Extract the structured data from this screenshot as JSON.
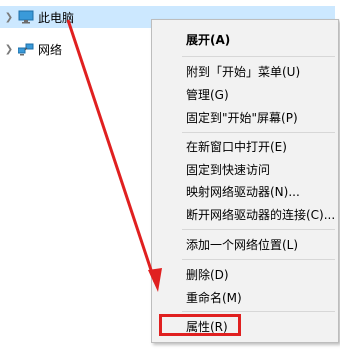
{
  "tree": {
    "this_pc": {
      "label": "此电脑",
      "icon": "computer-icon",
      "expand_icon": "chevron-right-icon"
    },
    "network": {
      "label": "网络",
      "icon": "network-icon",
      "expand_icon": "chevron-right-icon"
    }
  },
  "context_menu": {
    "items": [
      {
        "label": "展开(A)",
        "bold": true
      },
      {
        "label": "附到「开始」菜单(U)"
      },
      {
        "label": "管理(G)"
      },
      {
        "label": "固定到\"开始\"屏幕(P)"
      },
      {
        "label": "在新窗口中打开(E)"
      },
      {
        "label": "固定到快速访问"
      },
      {
        "label": "映射网络驱动器(N)..."
      },
      {
        "label": "断开网络驱动器的连接(C)..."
      },
      {
        "label": "添加一个网络位置(L)"
      },
      {
        "label": "删除(D)"
      },
      {
        "label": "重命名(M)"
      },
      {
        "label": "属性(R)"
      }
    ]
  },
  "annotation": {
    "arrow_color": "#e02020",
    "highlight_color": "#e02020"
  },
  "colors": {
    "selection": "#cce8ff",
    "menu_bg": "#f2f2f2"
  }
}
